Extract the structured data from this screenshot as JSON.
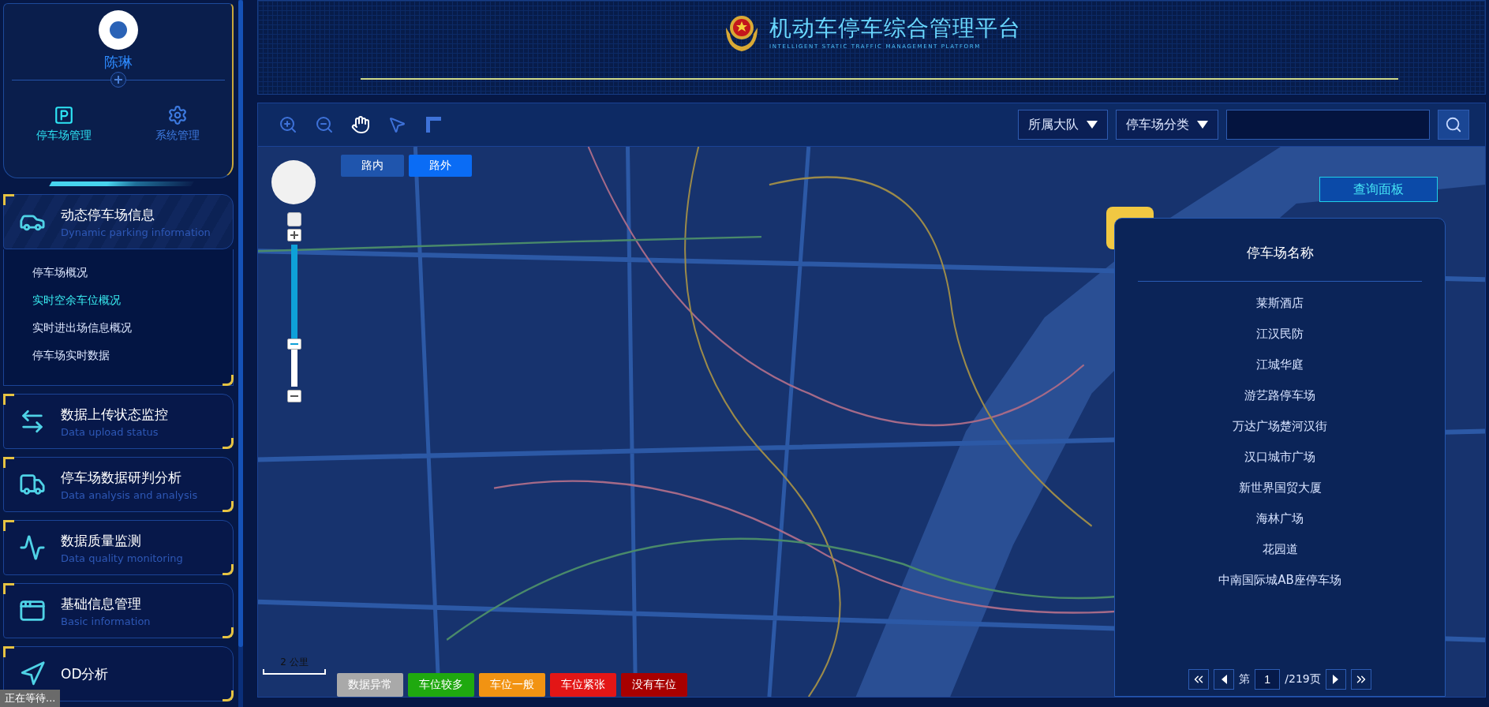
{
  "user": {
    "name": "陈琳"
  },
  "top_nav": [
    {
      "label": "停车场管理",
      "selected": true
    },
    {
      "label": "系统管理",
      "selected": false
    }
  ],
  "menu": [
    {
      "title": "动态停车场信息",
      "subtitle": "Dynamic parking information",
      "expanded": true,
      "children": [
        {
          "label": "停车场概况",
          "selected": false
        },
        {
          "label": "实时空余车位概况",
          "selected": true
        },
        {
          "label": "实时进出场信息概况",
          "selected": false
        },
        {
          "label": "停车场实时数据",
          "selected": false
        }
      ]
    },
    {
      "title": "数据上传状态监控",
      "subtitle": "Data upload status",
      "expanded": false
    },
    {
      "title": "停车场数据研判分析",
      "subtitle": "Data analysis and analysis",
      "expanded": false
    },
    {
      "title": "数据质量监测",
      "subtitle": "Data quality monitoring",
      "expanded": false
    },
    {
      "title": "基础信息管理",
      "subtitle": "Basic information",
      "expanded": false
    },
    {
      "title": "OD分析",
      "expanded": false
    }
  ],
  "header": {
    "title": "机动车停车综合管理平台",
    "subtitle": "INTELLIGENT STATIC TRAFFIC MANAGEMENT PLATFORM"
  },
  "toolbar": {
    "tools": [
      {
        "kind": "zoom-in"
      },
      {
        "kind": "zoom-out"
      },
      {
        "kind": "pan"
      },
      {
        "kind": "select"
      },
      {
        "kind": "measure"
      }
    ],
    "dropdowns": [
      {
        "label": "所属大队"
      },
      {
        "label": "停车场分类"
      }
    ]
  },
  "map": {
    "tabs": [
      {
        "label": "路内",
        "selected": false
      },
      {
        "label": "路外",
        "selected": true
      }
    ],
    "zoom": {
      "level": 0.3
    },
    "scale": "2 公里",
    "legend": [
      {
        "label": "数据异常",
        "color": "#a9a9a9"
      },
      {
        "label": "车位较多",
        "color": "#1fa90f"
      },
      {
        "label": "车位一般",
        "color": "#f29312"
      },
      {
        "label": "车位紧张",
        "color": "#e31616"
      },
      {
        "label": "没有车位",
        "color": "#a80000"
      }
    ],
    "query_button": "查询面板"
  },
  "panel": {
    "title": "停车场名称",
    "items": [
      "莱斯酒店",
      "江汉民防",
      "江城华庭",
      "游艺路停车场",
      "万达广场楚河汉街",
      "汉口城市广场",
      "新世界国贸大厦",
      "海林广场",
      "花园道",
      "中南国际城AB座停车场"
    ],
    "pagination": {
      "prefix": "第",
      "page": "1",
      "total": "/219页"
    }
  },
  "status": "正在等待..."
}
